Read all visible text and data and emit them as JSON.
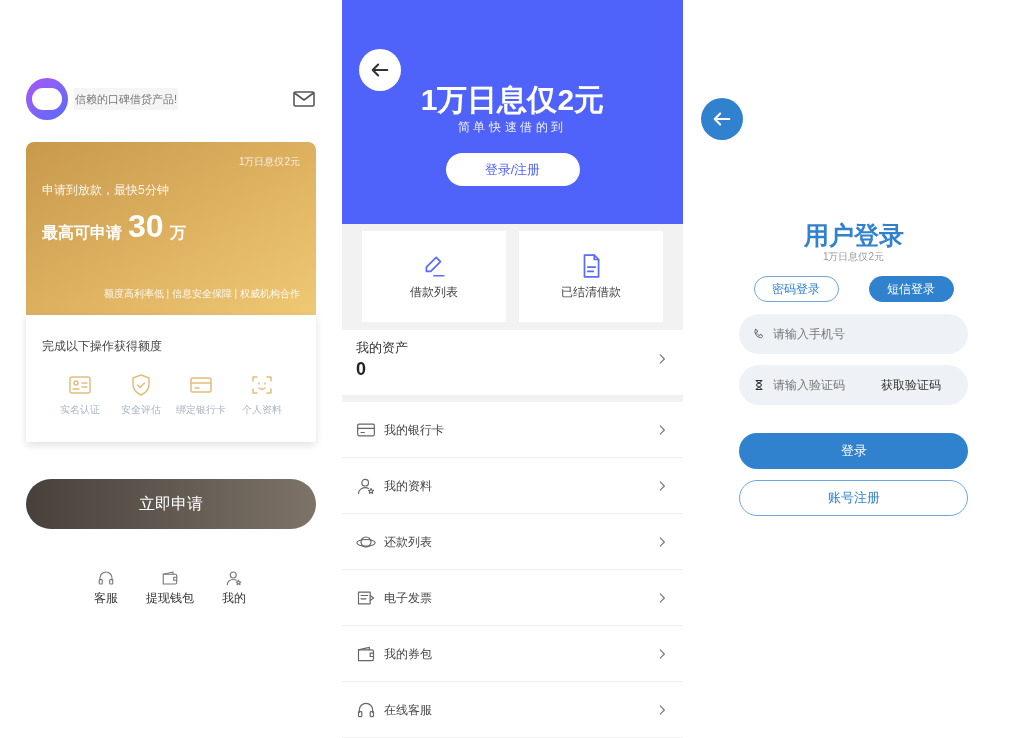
{
  "home": {
    "slogan": "信赖的口碑借贷产品!",
    "card": {
      "corner_text": "1万日息仅2元",
      "subtitle": "申请到放款，最快5分钟",
      "max_label": "最高可申请",
      "amount": "30",
      "unit": "万",
      "features": "额度高利率低 | 信息安全保障 | 权威机构合作"
    },
    "tasks": {
      "title": "完成以下操作获得额度",
      "items": [
        {
          "label": "实名认证",
          "kind": "id"
        },
        {
          "label": "安全评估",
          "kind": "shield"
        },
        {
          "label": "绑定银行卡",
          "kind": "card"
        },
        {
          "label": "个人资料",
          "kind": "face"
        }
      ]
    },
    "apply_button": "立即申请",
    "tab_bar": [
      {
        "label": "客服",
        "kind": "headset"
      },
      {
        "label": "提现钱包",
        "kind": "wallet"
      },
      {
        "label": "我的",
        "kind": "user"
      }
    ]
  },
  "center": {
    "banner": {
      "title": "1万日息仅2元",
      "subtitle": "简单快速借的到",
      "login_button": "登录/注册"
    },
    "shortcuts": [
      {
        "label": "借款列表",
        "kind": "pen"
      },
      {
        "label": "已结清借款",
        "kind": "doc"
      }
    ],
    "assets": {
      "label": "我的资产",
      "value": "0"
    },
    "menu": [
      {
        "label": "我的银行卡",
        "kind": "card"
      },
      {
        "label": "我的资料",
        "kind": "user"
      },
      {
        "label": "还款列表",
        "kind": "planet"
      },
      {
        "label": "电子发票",
        "kind": "invoice"
      },
      {
        "label": "我的券包",
        "kind": "wallet"
      },
      {
        "label": "在线客服",
        "kind": "headset"
      }
    ]
  },
  "login": {
    "title": "用户登录",
    "subtitle": "1万日息仅2元",
    "tabs": [
      {
        "label": "密码登录",
        "selected": false
      },
      {
        "label": "短信登录",
        "selected": true
      }
    ],
    "phone_field": {
      "placeholder": "请输入手机号"
    },
    "code_field": {
      "placeholder": "请输入验证码",
      "action": "获取验证码"
    },
    "login_button": "登录",
    "register_button": "账号注册"
  }
}
